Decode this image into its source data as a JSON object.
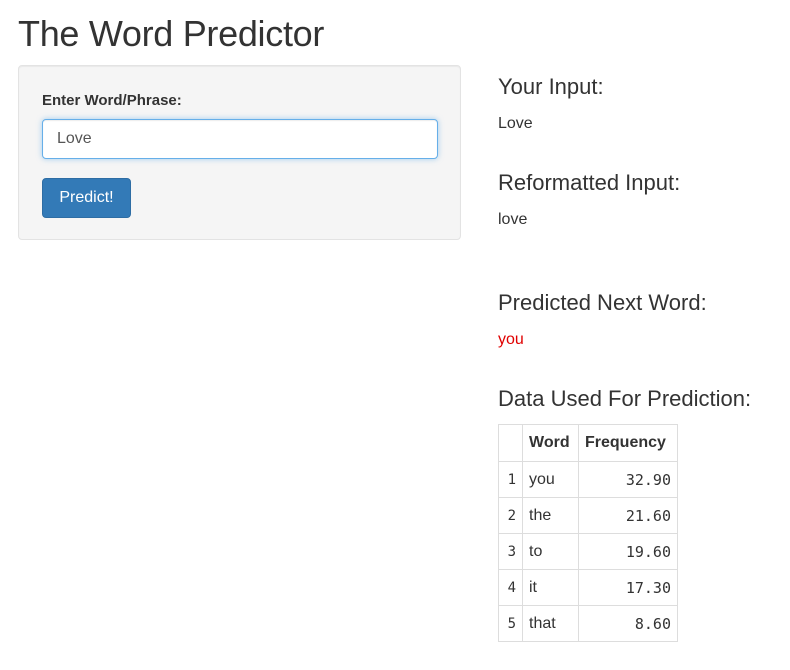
{
  "app": {
    "title": "The Word Predictor"
  },
  "form": {
    "label": "Enter Word/Phrase:",
    "input_value": "Love",
    "button_label": "Predict!"
  },
  "output": {
    "your_input_heading": "Your Input:",
    "your_input_value": "Love",
    "reformatted_heading": "Reformatted Input:",
    "reformatted_value": "love",
    "predicted_heading": "Predicted Next Word:",
    "predicted_value": "you",
    "predicted_color": "#e00000",
    "data_heading": "Data Used For Prediction:"
  },
  "table": {
    "columns": [
      "",
      "Word",
      "Frequency"
    ],
    "rows": [
      {
        "index": "1",
        "word": "you",
        "frequency": "32.90"
      },
      {
        "index": "2",
        "word": "the",
        "frequency": "21.60"
      },
      {
        "index": "3",
        "word": "to",
        "frequency": "19.60"
      },
      {
        "index": "4",
        "word": "it",
        "frequency": "17.30"
      },
      {
        "index": "5",
        "word": "that",
        "frequency": "8.60"
      }
    ]
  },
  "colors": {
    "button_bg": "#337ab7",
    "input_focus_border": "#66afe9",
    "panel_bg": "#f5f5f5"
  }
}
